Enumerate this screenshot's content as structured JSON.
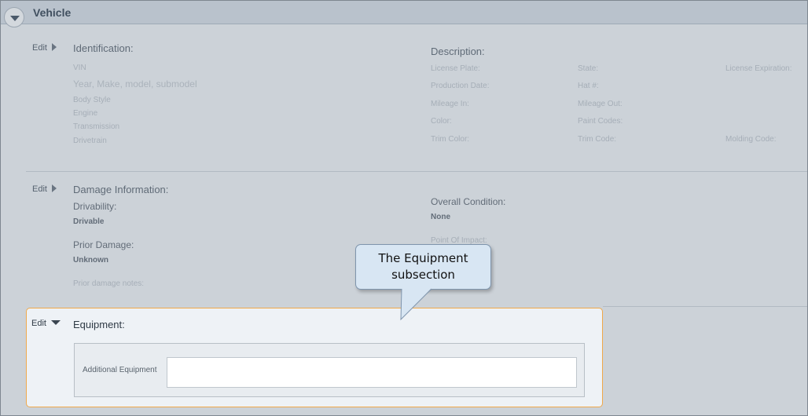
{
  "header": {
    "title": "Vehicle",
    "toggle_icon": "chevron-down-icon"
  },
  "identification": {
    "edit_label": "Edit",
    "title": "Identification:",
    "fields": [
      "VIN",
      "Year, Make, model, submodel",
      "Body Style",
      "Engine",
      "Transmission",
      "Drivetrain"
    ]
  },
  "description": {
    "title": "Description:",
    "col1": [
      "License Plate:",
      "Production Date:",
      "Mileage In:",
      "Color:",
      "Trim Color:"
    ],
    "col2": [
      "State:",
      "Hat #:",
      "Mileage Out:",
      "Paint Codes:",
      "Trim Code:"
    ],
    "col3_top": "License Expiration:",
    "col3_bottom": "Molding Code:"
  },
  "damage": {
    "edit_label": "Edit",
    "title": "Damage Information:",
    "drivability_label": "Drivability:",
    "drivability_value": "Drivable",
    "prior_damage_label": "Prior Damage:",
    "prior_damage_value": "Unknown",
    "prior_notes_label": "Prior damage notes:",
    "overall_condition_label": "Overall Condition:",
    "overall_condition_value": "None",
    "point_of_impact_label": "Point Of Impact:"
  },
  "equipment": {
    "edit_label": "Edit",
    "title": "Equipment:",
    "additional_label": "Additional Equipment",
    "additional_value": ""
  },
  "callout": {
    "line1": "The Equipment",
    "line2": "subsection"
  },
  "colors": {
    "highlight_border": "#f0a94a",
    "callout_fill": "#d8e6f3",
    "header_bar": "#d3dae1"
  }
}
